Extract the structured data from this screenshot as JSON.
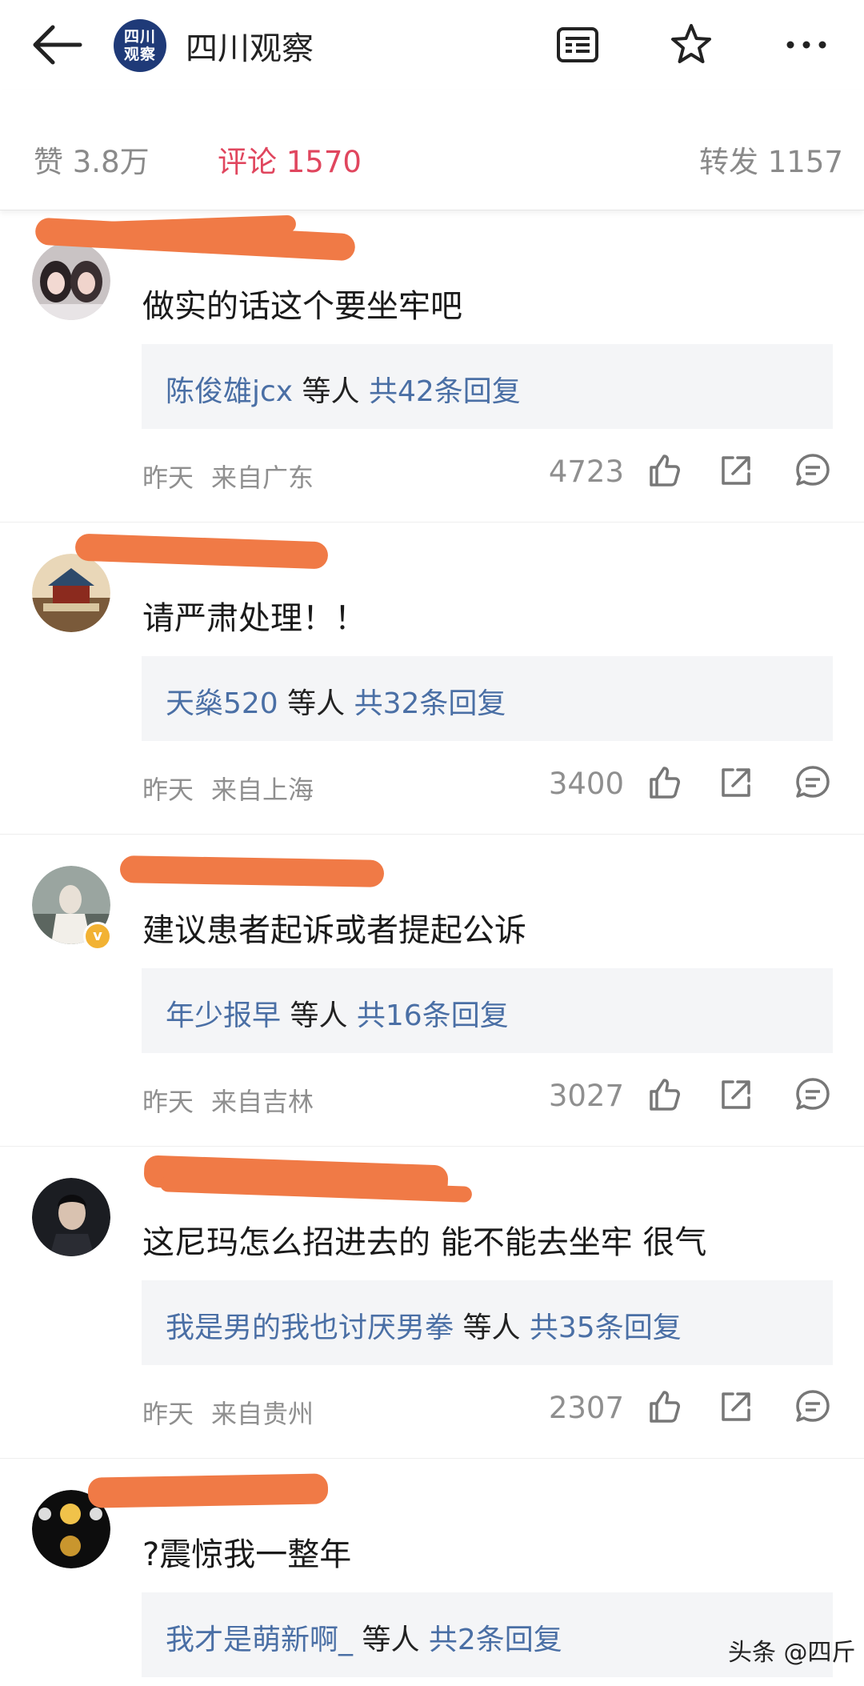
{
  "header": {
    "account_name": "四川观察",
    "logo_line1": "四川",
    "logo_line2": "观察",
    "icons": [
      "back-arrow-icon",
      "reader-icon",
      "star-icon",
      "more-icon"
    ]
  },
  "stats": {
    "likes": "赞 3.8万",
    "comments": "评论 1570",
    "reposts": "转发 1157"
  },
  "comments": [
    {
      "text": "做实的话这个要坐牢吧",
      "reply_name": "陈俊雄jcx",
      "reply_mid": " 等人 ",
      "reply_count": "共42条回复",
      "time": "昨天",
      "location": "来自广东",
      "likes": "4723"
    },
    {
      "text": "请严肃处理！！",
      "reply_name": "天燊520",
      "reply_mid": " 等人 ",
      "reply_count": "共32条回复",
      "time": "昨天",
      "location": "来自上海",
      "likes": "3400"
    },
    {
      "text": "建议患者起诉或者提起公诉",
      "reply_name": "年少报早",
      "reply_mid": " 等人 ",
      "reply_count": "共16条回复",
      "time": "昨天",
      "location": "来自吉林",
      "likes": "3027"
    },
    {
      "text": "这尼玛怎么招进去的 能不能去坐牢 很气",
      "reply_name": "我是男的我也讨厌男拳",
      "reply_mid": " 等人 ",
      "reply_count": "共35条回复",
      "time": "昨天",
      "location": "来自贵州",
      "likes": "2307"
    },
    {
      "text": "?震惊我一整年",
      "reply_name": "我才是萌新啊_",
      "reply_mid": " 等人 ",
      "reply_count": "共2条回复",
      "time": "",
      "location": "",
      "likes": ""
    }
  ],
  "watermark": "头条 @四斤",
  "colors": {
    "accent": "#e0465e",
    "link": "#4a6fa5",
    "redaction": "#f07a46",
    "reply_bg": "#f4f5f7"
  }
}
